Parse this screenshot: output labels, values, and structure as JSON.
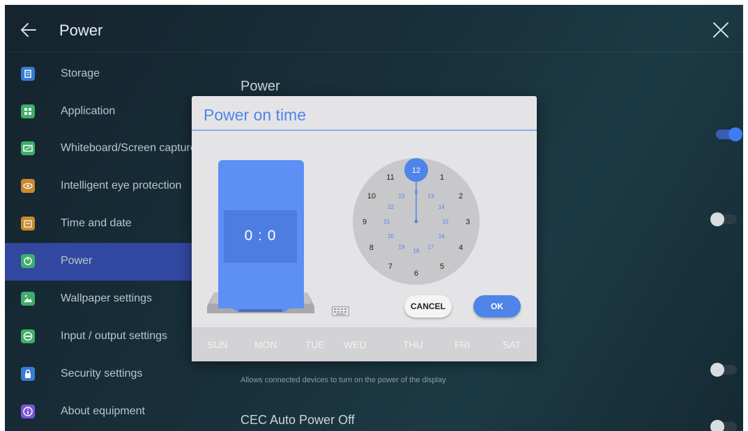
{
  "header": {
    "title": "Power",
    "back_icon": "arrow-left-icon",
    "close_icon": "close-icon"
  },
  "sidebar": {
    "items": [
      {
        "label": "Storage",
        "icon": "storage-icon",
        "color": "#3a7bd5"
      },
      {
        "label": "Application",
        "icon": "apps-grid-icon",
        "color": "#3fae6a"
      },
      {
        "label": "Whiteboard/Screen capture",
        "icon": "screenshot-icon",
        "color": "#3fae6a"
      },
      {
        "label": "Intelligent eye protection",
        "icon": "eye-icon",
        "color": "#c98a2e"
      },
      {
        "label": "Time and date",
        "icon": "calendar-icon",
        "color": "#c98a2e"
      },
      {
        "label": "Power",
        "icon": "power-icon",
        "color": "#3fae6a",
        "active": true
      },
      {
        "label": "Wallpaper settings",
        "icon": "image-icon",
        "color": "#3fae6a"
      },
      {
        "label": "Input / output settings",
        "icon": "input-output-icon",
        "color": "#3fae6a"
      },
      {
        "label": "Security settings",
        "icon": "lock-icon",
        "color": "#3a7bd5"
      },
      {
        "label": "About equipment",
        "icon": "info-icon",
        "color": "#7a55d6"
      }
    ]
  },
  "content": {
    "section_title": "Power",
    "cec_desc": "Allows connected devices to turn on the power of the display",
    "cec_off_title": "CEC Auto Power Off"
  },
  "dialog": {
    "title": "Power on time",
    "time_display": "0 : 0",
    "cancel_label": "CANCEL",
    "ok_label": "OK",
    "days": [
      "SUN",
      "MON",
      "TUE",
      "WED",
      "THU",
      "FRI",
      "SAT"
    ],
    "clock": {
      "outer_hours": [
        "12",
        "1",
        "2",
        "3",
        "4",
        "5",
        "6",
        "7",
        "8",
        "9",
        "10",
        "11"
      ],
      "inner_hours": [
        "0",
        "13",
        "14",
        "15",
        "16",
        "17",
        "18",
        "19",
        "20",
        "21",
        "22",
        "23"
      ],
      "selected": "12"
    }
  },
  "colors": {
    "accent": "#4f84e8",
    "sidebar_active": "#3248a0",
    "toggle_on": "#3f7cf0"
  }
}
